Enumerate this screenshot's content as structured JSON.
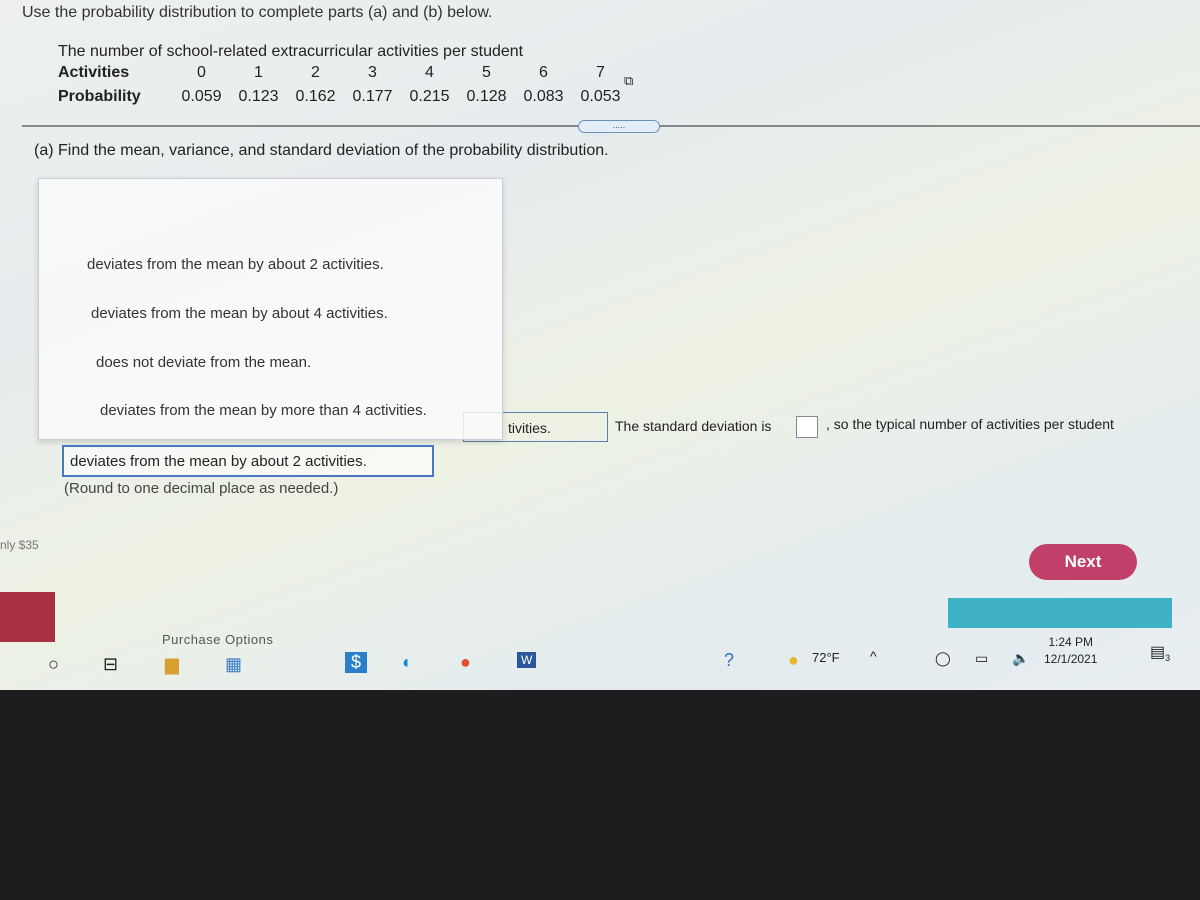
{
  "instruction": "Use the probability distribution to complete parts (a) and (b) below.",
  "table": {
    "title": "The number of school-related extracurricular activities per student",
    "row_labels": [
      "Activities",
      "Probability"
    ],
    "activities": [
      "0",
      "1",
      "2",
      "3",
      "4",
      "5",
      "6",
      "7"
    ],
    "probabilities": [
      "0.059",
      "0.123",
      "0.162",
      "0.177",
      "0.215",
      "0.128",
      "0.083",
      "0.053"
    ]
  },
  "more_button": ".....",
  "part_a": "(a) Find the mean, variance, and standard deviation of the probability distribution.",
  "dropdown_options": [
    "deviates from the mean by about 2 activities.",
    "deviates from the mean by about 4 activities.",
    "does not deviate from the mean.",
    "deviates from the mean by more than 4 activities."
  ],
  "answer_fragment": "tivities.",
  "sd_text": "The standard deviation is",
  "sd_rest": ", so the typical number of activities per student",
  "selected": "deviates from the mean by about 2 activities.",
  "round_note": "(Round to one decimal place as needed.)",
  "price_text": "nly $35",
  "next_label": "Next",
  "purchase": "Purchase Options",
  "taskbar": {
    "temp": "72°F",
    "time": "1:24 PM",
    "date": "12/1/2021",
    "notifications": "3"
  },
  "colors": {
    "next": "#c0406a",
    "accent": "#4a78c0",
    "teal": "#3fb2c8"
  }
}
